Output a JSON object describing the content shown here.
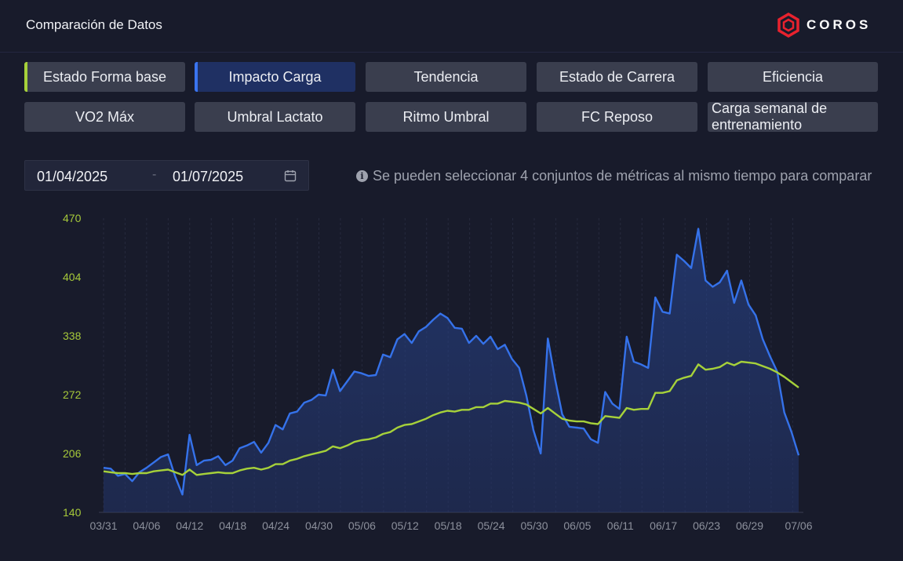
{
  "header": {
    "title": "Comparación de Datos",
    "logo_text": "COROS",
    "logo_icon": "hexagon-logo-icon",
    "accent_color": "#e8222e"
  },
  "tabs": [
    {
      "label": "Estado Forma base",
      "active": true,
      "marker_color": "#a6d13a"
    },
    {
      "label": "Impacto Carga",
      "active": true,
      "marker_color": "#3a74f0"
    },
    {
      "label": "Tendencia",
      "active": false
    },
    {
      "label": "Estado de Carrera",
      "active": false
    },
    {
      "label": "Eficiencia",
      "active": false
    },
    {
      "label": "VO2 Máx",
      "active": false
    },
    {
      "label": "Umbral Lactato",
      "active": false
    },
    {
      "label": "Ritmo Umbral",
      "active": false
    },
    {
      "label": "FC Reposo",
      "active": false
    },
    {
      "label": "Carga semanal de entrenamiento",
      "active": false
    }
  ],
  "daterange": {
    "start": "01/04/2025",
    "separator": "-",
    "end": "01/07/2025",
    "icon": "calendar-icon"
  },
  "hint": {
    "icon": "info-icon",
    "text": "Se pueden seleccionar 4 conjuntos de métricas al mismo tiempo para comparar"
  },
  "chart_data": {
    "type": "line",
    "ylim": [
      140,
      470
    ],
    "y_ticks": [
      "470",
      "404",
      "338",
      "272",
      "206",
      "140"
    ],
    "x_ticks": [
      "03/31",
      "04/06",
      "04/12",
      "04/18",
      "04/24",
      "04/30",
      "05/06",
      "05/12",
      "05/18",
      "05/24",
      "05/30",
      "06/05",
      "06/11",
      "06/17",
      "06/23",
      "06/29",
      "07/06"
    ],
    "colors": {
      "load_impact": "#3572ea",
      "base_fitness": "#a6d13a"
    },
    "series": [
      {
        "key": "load_impact",
        "values": [
          190,
          189,
          181,
          183,
          175,
          185,
          190,
          196,
          202,
          205,
          180,
          160,
          227,
          193,
          198,
          199,
          203,
          193,
          198,
          212,
          215,
          219,
          207,
          218,
          238,
          233,
          251,
          253,
          263,
          266,
          272,
          271,
          300,
          276,
          287,
          298,
          296,
          293,
          294,
          317,
          314,
          334,
          340,
          330,
          343,
          348,
          356,
          363,
          358,
          347,
          346,
          330,
          338,
          329,
          337,
          323,
          328,
          312,
          302,
          271,
          232,
          206,
          335,
          290,
          250,
          236,
          235,
          234,
          222,
          218,
          275,
          262,
          256,
          337,
          309,
          306,
          302,
          381,
          365,
          363,
          429,
          422,
          414,
          458,
          400,
          393,
          398,
          411,
          375,
          400,
          373,
          361,
          334,
          315,
          298,
          252,
          230,
          204
        ]
      },
      {
        "key": "base_fitness",
        "values": [
          186,
          185,
          184,
          184,
          183,
          184,
          184,
          186,
          187,
          188,
          185,
          182,
          188,
          182,
          183,
          184,
          185,
          184,
          184,
          187,
          189,
          190,
          188,
          190,
          194,
          194,
          198,
          200,
          203,
          205,
          207,
          209,
          214,
          212,
          215,
          219,
          221,
          222,
          224,
          228,
          230,
          235,
          238,
          239,
          242,
          245,
          249,
          252,
          254,
          253,
          255,
          255,
          258,
          258,
          262,
          262,
          265,
          264,
          263,
          261,
          256,
          251,
          257,
          251,
          245,
          243,
          242,
          242,
          240,
          239,
          248,
          247,
          246,
          257,
          255,
          256,
          256,
          274,
          274,
          276,
          288,
          291,
          293,
          306,
          300,
          301,
          303,
          308,
          305,
          309,
          308,
          307,
          304,
          301,
          297,
          292,
          286,
          280
        ]
      }
    ]
  }
}
